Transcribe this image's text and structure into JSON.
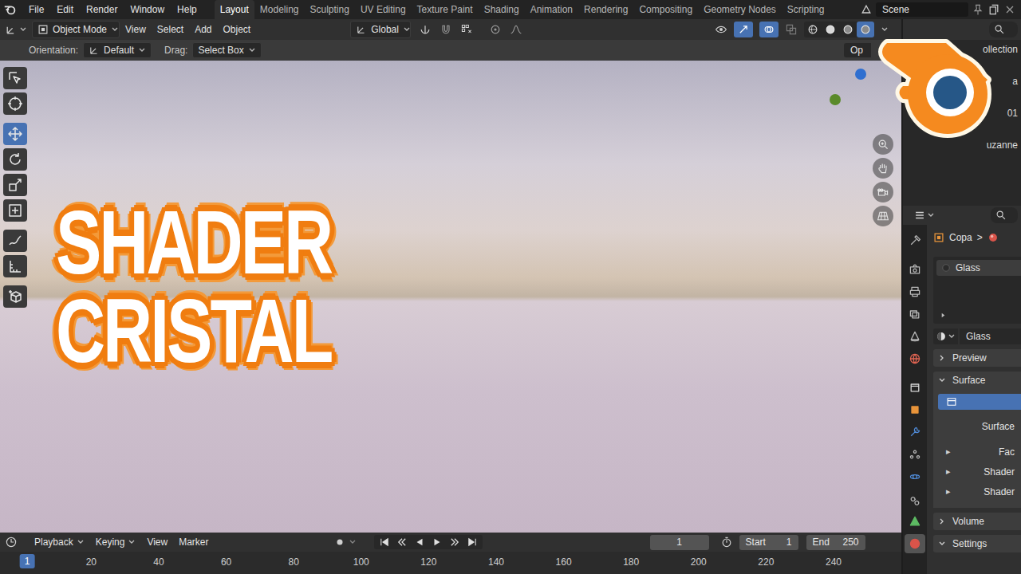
{
  "topbar": {
    "menus": [
      "File",
      "Edit",
      "Render",
      "Window",
      "Help"
    ],
    "workspaces": [
      {
        "label": "Layout",
        "selected": true
      },
      {
        "label": "Modeling",
        "selected": false
      },
      {
        "label": "Sculpting",
        "selected": false
      },
      {
        "label": "UV Editing",
        "selected": false
      },
      {
        "label": "Texture Paint",
        "selected": false
      },
      {
        "label": "Shading",
        "selected": false
      },
      {
        "label": "Animation",
        "selected": false
      },
      {
        "label": "Rendering",
        "selected": false
      },
      {
        "label": "Compositing",
        "selected": false
      },
      {
        "label": "Geometry Nodes",
        "selected": false
      },
      {
        "label": "Scripting",
        "selected": false
      }
    ],
    "scene": "Scene"
  },
  "viewport_header": {
    "mode": "Object Mode",
    "menus": [
      "View",
      "Select",
      "Add",
      "Object"
    ],
    "transform_orientation": "Global",
    "shading": [
      {
        "selected": false
      },
      {
        "selected": false
      },
      {
        "selected": false
      },
      {
        "selected": true
      }
    ]
  },
  "tool_settings": {
    "orientation_label": "Orientation:",
    "orientation": "Default",
    "drag_label": "Drag:",
    "drag": "Select Box",
    "options": "Op"
  },
  "toolbar": [
    {
      "selected": false
    },
    {
      "selected": false
    },
    {
      "selected": true
    },
    {
      "selected": false
    },
    {
      "selected": false
    },
    {
      "selected": false
    },
    {
      "selected": false
    },
    {
      "selected": false
    },
    {
      "selected": false
    }
  ],
  "thumbnail_title": [
    "SHADER",
    "CRISTAL"
  ],
  "outliner": {
    "items": [
      "ollection",
      "a",
      "01",
      "uzanne"
    ]
  },
  "properties": {
    "tabs": [
      {
        "selected": false
      },
      {
        "selected": false
      },
      {
        "selected": false
      },
      {
        "selected": false
      },
      {
        "selected": false
      },
      {
        "selected": false
      },
      {
        "selected": false
      },
      {
        "selected": false
      },
      {
        "selected": false
      },
      {
        "selected": false
      },
      {
        "selected": false
      },
      {
        "selected": false
      },
      {
        "selected": false
      },
      {
        "selected": true
      }
    ],
    "breadcrumb": {
      "object": "Copa",
      "separator": ">"
    },
    "material_slots": [
      {
        "label": "Glass",
        "selected": true
      }
    ],
    "material": "Glass",
    "panels": [
      {
        "label": "Preview",
        "expanded": false
      },
      {
        "label": "Surface",
        "expanded": true
      },
      {
        "label": "Volume",
        "expanded": false
      },
      {
        "label": "Settings",
        "expanded": true
      }
    ],
    "surface": {
      "label": "Surface",
      "sockets": [
        {
          "label": "Fac",
          "arrow": "▸"
        },
        {
          "label": "Shader",
          "arrow": "▸"
        },
        {
          "label": "Shader",
          "arrow": "▸"
        }
      ]
    }
  },
  "timeline": {
    "menus": [
      "Playback",
      "Keying",
      "View",
      "Marker"
    ],
    "current_frame": "1",
    "start_label": "Start",
    "start": "1",
    "end_label": "End",
    "end": "250",
    "ruler": {
      "current": "1",
      "ticks": [
        "20",
        "40",
        "60",
        "80",
        "100",
        "120",
        "140",
        "160",
        "180",
        "200",
        "220",
        "240"
      ]
    }
  }
}
